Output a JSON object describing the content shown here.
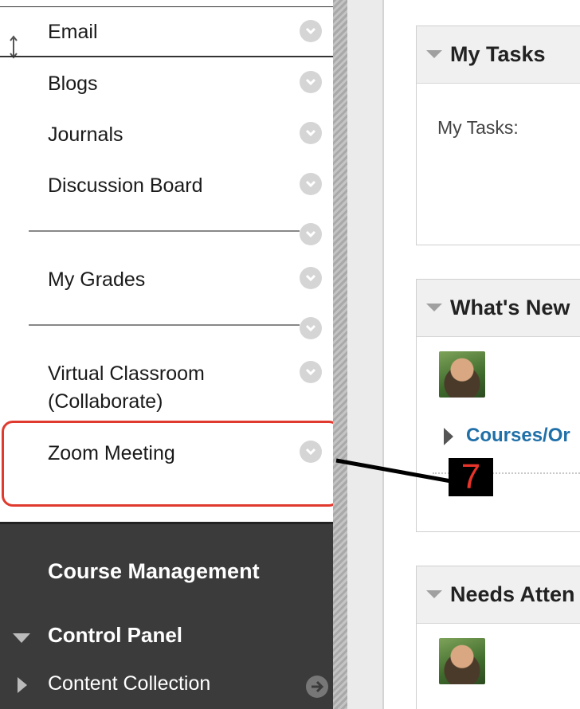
{
  "course_menu": {
    "items": [
      {
        "label": "Email"
      },
      {
        "label": "Blogs"
      },
      {
        "label": "Journals"
      },
      {
        "label": "Discussion Board"
      },
      {
        "label": "My Grades"
      },
      {
        "label": "Virtual Classroom"
      },
      {
        "label": "(Collaborate)"
      },
      {
        "label": "Zoom Meeting"
      }
    ]
  },
  "management": {
    "title": "Course Management",
    "control_panel": "Control Panel",
    "content_collection": "Content Collection"
  },
  "modules": {
    "my_tasks": {
      "title": "My Tasks",
      "body": "My Tasks:"
    },
    "whats_new": {
      "title": "What's New",
      "link": "Courses/Or"
    },
    "needs_attention": {
      "title": "Needs Atten"
    }
  },
  "callout": {
    "number": "7",
    "color": "#e03a2e"
  },
  "icons": [
    "drag-handle-icon",
    "chevron-down-icon",
    "collapse-triangle-icon",
    "expand-triangle-icon",
    "go-arrow-icon",
    "user-avatar"
  ]
}
